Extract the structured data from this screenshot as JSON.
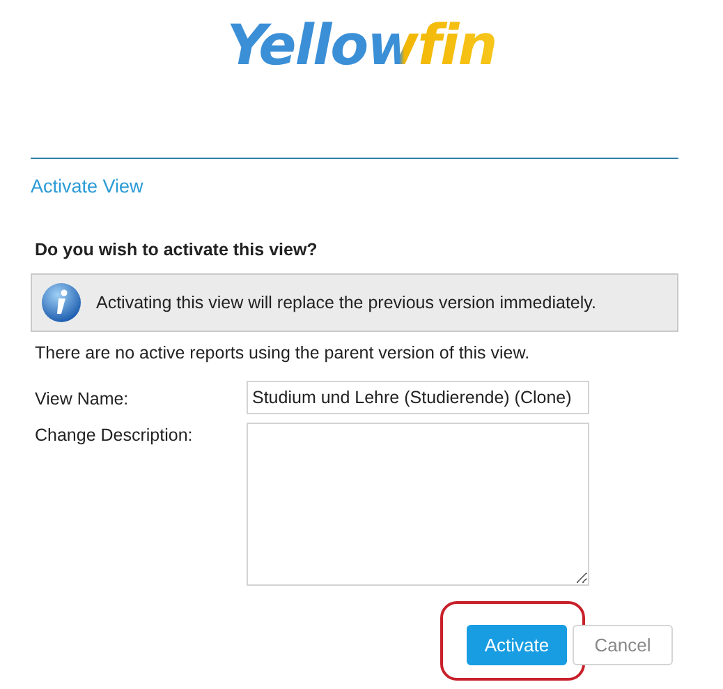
{
  "logo": {
    "text": "Yellowfin"
  },
  "title": "Activate View",
  "question": "Do you wish to activate this view?",
  "info": {
    "text": "Activating this view will replace the previous version immediately."
  },
  "note": "There are no active reports using the parent version of this view.",
  "fields": [
    {
      "label": "View Name:",
      "kind": "input",
      "value": "Studium und Lehre (Studierende) (Clone)"
    },
    {
      "label": "Change Description:",
      "kind": "textarea"
    }
  ],
  "buttons": [
    {
      "label": "Activate",
      "primary": true,
      "circled": true
    },
    {
      "label": "Cancel",
      "primary": false,
      "circled": false
    }
  ]
}
